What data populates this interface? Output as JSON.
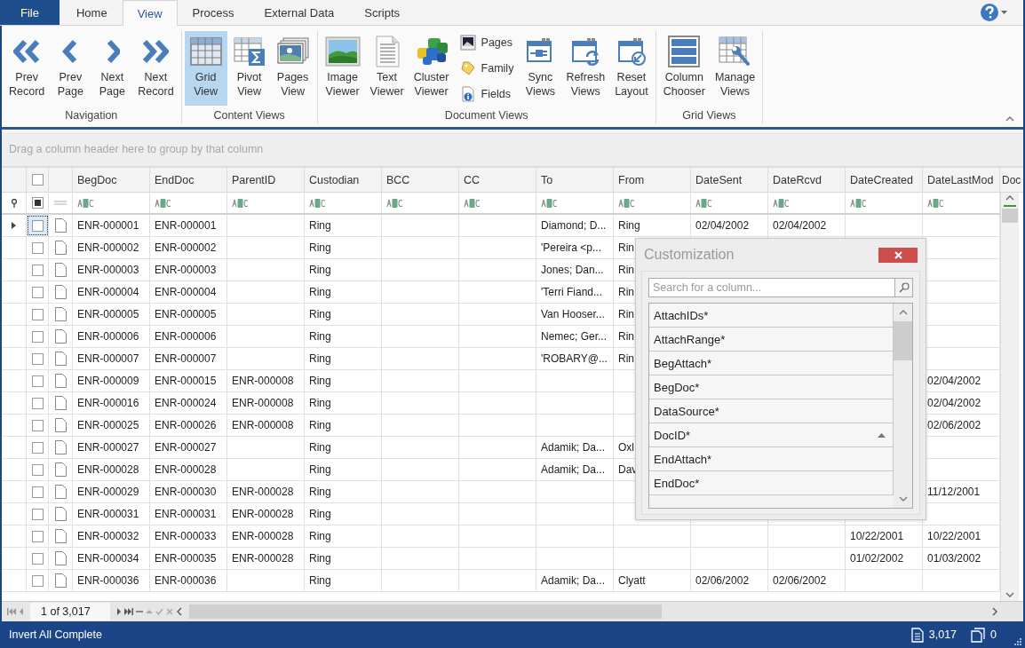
{
  "tabs": [
    {
      "label": "File",
      "kind": "file",
      "selected": false
    },
    {
      "label": "Home",
      "kind": "tab",
      "selected": false
    },
    {
      "label": "View",
      "kind": "tab",
      "selected": true
    },
    {
      "label": "Process",
      "kind": "tab",
      "selected": false
    },
    {
      "label": "External Data",
      "kind": "tab",
      "selected": false
    },
    {
      "label": "Scripts",
      "kind": "tab",
      "selected": false
    }
  ],
  "ribbon": {
    "groups": [
      {
        "title": "Navigation",
        "buttons": [
          {
            "kind": "large",
            "label": "Prev Record",
            "selected": false
          },
          {
            "kind": "large",
            "label": "Prev Page",
            "selected": false
          },
          {
            "kind": "large",
            "label": "Next Page",
            "selected": false
          },
          {
            "kind": "large",
            "label": "Next Record",
            "selected": false
          }
        ]
      },
      {
        "title": "Content Views",
        "buttons": [
          {
            "kind": "large",
            "label": "Grid View",
            "selected": true
          },
          {
            "kind": "large",
            "label": "Pivot View",
            "selected": false
          },
          {
            "kind": "large",
            "label": "Pages View",
            "selected": false
          }
        ]
      },
      {
        "title": "Document Views",
        "buttons": [
          {
            "kind": "large",
            "label": "Image Viewer",
            "selected": false
          },
          {
            "kind": "large",
            "label": "Text Viewer",
            "selected": false
          },
          {
            "kind": "large",
            "label": "Cluster Viewer",
            "selected": false
          },
          {
            "kind": "stack",
            "items": [
              {
                "label": "Pages"
              },
              {
                "label": "Family"
              },
              {
                "label": "Fields"
              }
            ]
          },
          {
            "kind": "large",
            "label": "Sync Views",
            "selected": false
          },
          {
            "kind": "large",
            "label": "Refresh Views",
            "selected": false
          },
          {
            "kind": "large",
            "label": "Reset Layout",
            "selected": false
          }
        ]
      },
      {
        "title": "Grid Views",
        "buttons": [
          {
            "kind": "large",
            "label": "Column Chooser",
            "selected": false
          },
          {
            "kind": "large",
            "label": "Manage Views",
            "selected": false
          }
        ]
      }
    ]
  },
  "grid": {
    "group_panel_hint": "Drag a column header here to group by that column",
    "select_all": {
      "checked": false
    },
    "filter_checkbox": {
      "checked": true
    },
    "columns": [
      {
        "label": "BegDoc"
      },
      {
        "label": "EndDoc"
      },
      {
        "label": "ParentID"
      },
      {
        "label": "Custodian"
      },
      {
        "label": "BCC"
      },
      {
        "label": "CC"
      },
      {
        "label": "To"
      },
      {
        "label": "From"
      },
      {
        "label": "DateSent"
      },
      {
        "label": "DateRcvd"
      },
      {
        "label": "DateCreated"
      },
      {
        "label": "DateLastMod"
      },
      {
        "label": "Doc"
      }
    ],
    "rows": [
      {
        "selected": true,
        "checked": false,
        "begdoc": "ENR-000001",
        "enddoc": "ENR-000001",
        "custodian": "Ring",
        "to": "Diamond; D...",
        "from": "Ring",
        "date_sent": "02/04/2002",
        "date_rcvd": "02/04/2002"
      },
      {
        "selected": false,
        "checked": false,
        "begdoc": "ENR-000002",
        "enddoc": "ENR-000002",
        "custodian": "Ring",
        "to": "'Pereira <p...",
        "from": "Rin"
      },
      {
        "selected": false,
        "checked": false,
        "begdoc": "ENR-000003",
        "enddoc": "ENR-000003",
        "custodian": "Ring",
        "to": "Jones; Dan...",
        "from": "Rin"
      },
      {
        "selected": false,
        "checked": false,
        "begdoc": "ENR-000004",
        "enddoc": "ENR-000004",
        "custodian": "Ring",
        "to": "'Terri Fiand...",
        "from": "Rin"
      },
      {
        "selected": false,
        "checked": false,
        "begdoc": "ENR-000005",
        "enddoc": "ENR-000005",
        "custodian": "Ring",
        "to": "Van Hooser...",
        "from": "Rin"
      },
      {
        "selected": false,
        "checked": false,
        "begdoc": "ENR-000006",
        "enddoc": "ENR-000006",
        "custodian": "Ring",
        "to": "Nemec; Ger...",
        "from": "Rin"
      },
      {
        "selected": false,
        "checked": false,
        "begdoc": "ENR-000007",
        "enddoc": "ENR-000007",
        "custodian": "Ring",
        "to": "'ROBARY@...",
        "from": "Rin"
      },
      {
        "selected": false,
        "checked": false,
        "begdoc": "ENR-000009",
        "enddoc": "ENR-000015",
        "parent_id": "ENR-000008",
        "custodian": "Ring",
        "date_last_mod": "02/04/2002"
      },
      {
        "selected": false,
        "checked": false,
        "begdoc": "ENR-000016",
        "enddoc": "ENR-000024",
        "parent_id": "ENR-000008",
        "custodian": "Ring",
        "date_last_mod": "02/04/2002"
      },
      {
        "selected": false,
        "checked": false,
        "begdoc": "ENR-000025",
        "enddoc": "ENR-000026",
        "parent_id": "ENR-000008",
        "custodian": "Ring",
        "date_last_mod": "02/06/2002"
      },
      {
        "selected": false,
        "checked": false,
        "begdoc": "ENR-000027",
        "enddoc": "ENR-000027",
        "custodian": "Ring",
        "to": "Adamik; Da...",
        "from": "Oxl"
      },
      {
        "selected": false,
        "checked": false,
        "begdoc": "ENR-000028",
        "enddoc": "ENR-000028",
        "custodian": "Ring",
        "to": "Adamik; Da...",
        "from": "Dav"
      },
      {
        "selected": false,
        "checked": false,
        "begdoc": "ENR-000029",
        "enddoc": "ENR-000030",
        "parent_id": "ENR-000028",
        "custodian": "Ring",
        "date_last_mod": "11/12/2001"
      },
      {
        "selected": false,
        "checked": false,
        "begdoc": "ENR-000031",
        "enddoc": "ENR-000031",
        "parent_id": "ENR-000028",
        "custodian": "Ring"
      },
      {
        "selected": false,
        "checked": false,
        "begdoc": "ENR-000032",
        "enddoc": "ENR-000033",
        "parent_id": "ENR-000028",
        "custodian": "Ring",
        "date_created": "10/22/2001",
        "date_last_mod": "10/22/2001"
      },
      {
        "selected": false,
        "checked": false,
        "begdoc": "ENR-000034",
        "enddoc": "ENR-000035",
        "parent_id": "ENR-000028",
        "custodian": "Ring",
        "date_created": "01/02/2002",
        "date_last_mod": "01/03/2002"
      },
      {
        "selected": false,
        "checked": false,
        "begdoc": "ENR-000036",
        "enddoc": "ENR-000036",
        "custodian": "Ring",
        "to": "Adamik; Da...",
        "from": "Clyatt",
        "date_sent": "02/06/2002",
        "date_rcvd": "02/06/2002"
      }
    ],
    "navigator": {
      "position": "1 of 3,017"
    }
  },
  "customization": {
    "title": "Customization",
    "search": {
      "placeholder": "Search for a column..."
    },
    "items": [
      {
        "label": "AttachIDs*",
        "sorted": false
      },
      {
        "label": "AttachRange*",
        "sorted": false
      },
      {
        "label": "BegAttach*",
        "sorted": false
      },
      {
        "label": "BegDoc*",
        "sorted": false
      },
      {
        "label": "DataSource*",
        "sorted": false
      },
      {
        "label": "DocID*",
        "sorted": true
      },
      {
        "label": "EndAttach*",
        "sorted": false
      },
      {
        "label": "EndDoc*",
        "sorted": false
      }
    ]
  },
  "status_bar": {
    "message": "Invert All Complete",
    "documents": "3,017",
    "pages": "0"
  }
}
